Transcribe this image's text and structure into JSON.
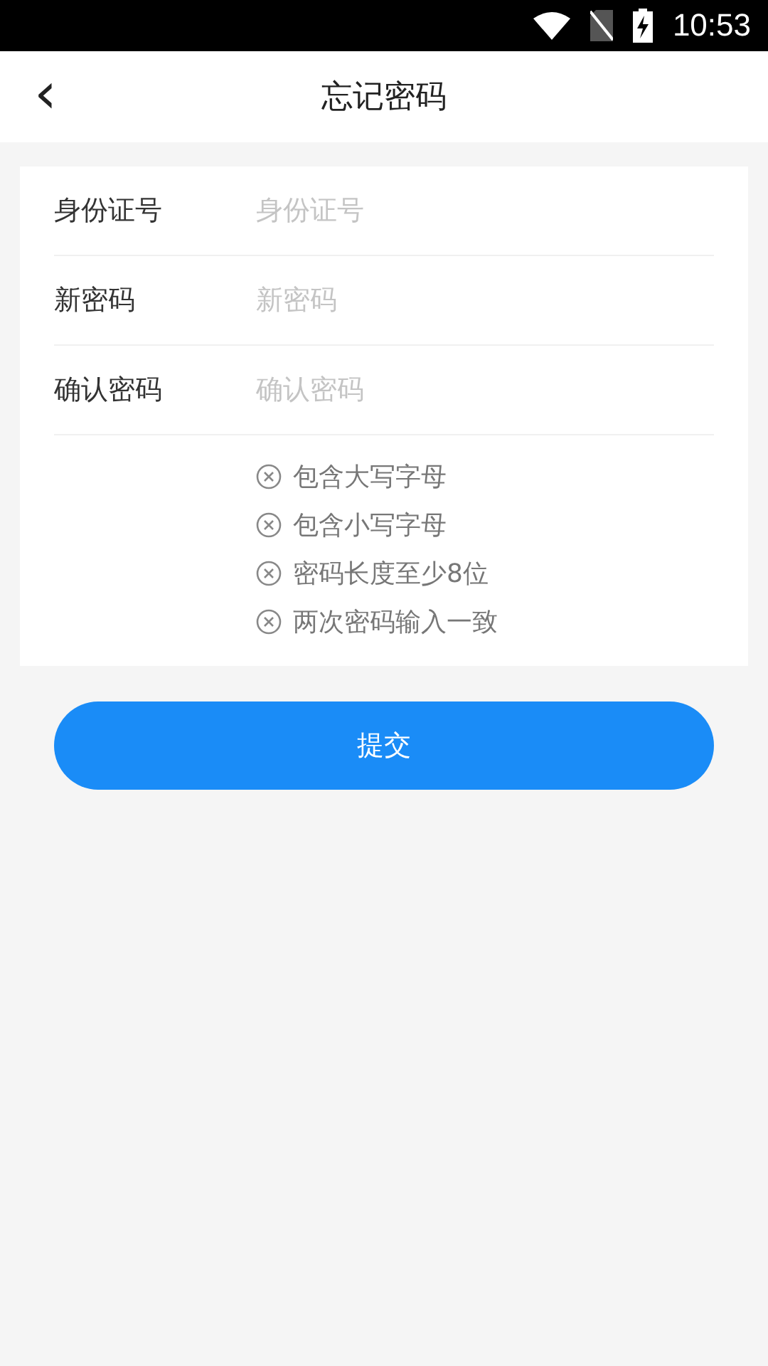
{
  "status_bar": {
    "time": "10:53"
  },
  "header": {
    "back_icon": "‹",
    "title": "忘记密码"
  },
  "fields": [
    {
      "label": "身份证号",
      "placeholder": "身份证号"
    },
    {
      "label": "新密码",
      "placeholder": "新密码"
    },
    {
      "label": "确认密码",
      "placeholder": "确认密码"
    }
  ],
  "rules": [
    {
      "text": "包含大写字母",
      "met": false
    },
    {
      "text": "包含小写字母",
      "met": false
    },
    {
      "text": "密码长度至少8位",
      "met": false
    },
    {
      "text": "两次密码输入一致",
      "met": false
    }
  ],
  "submit": "提交"
}
